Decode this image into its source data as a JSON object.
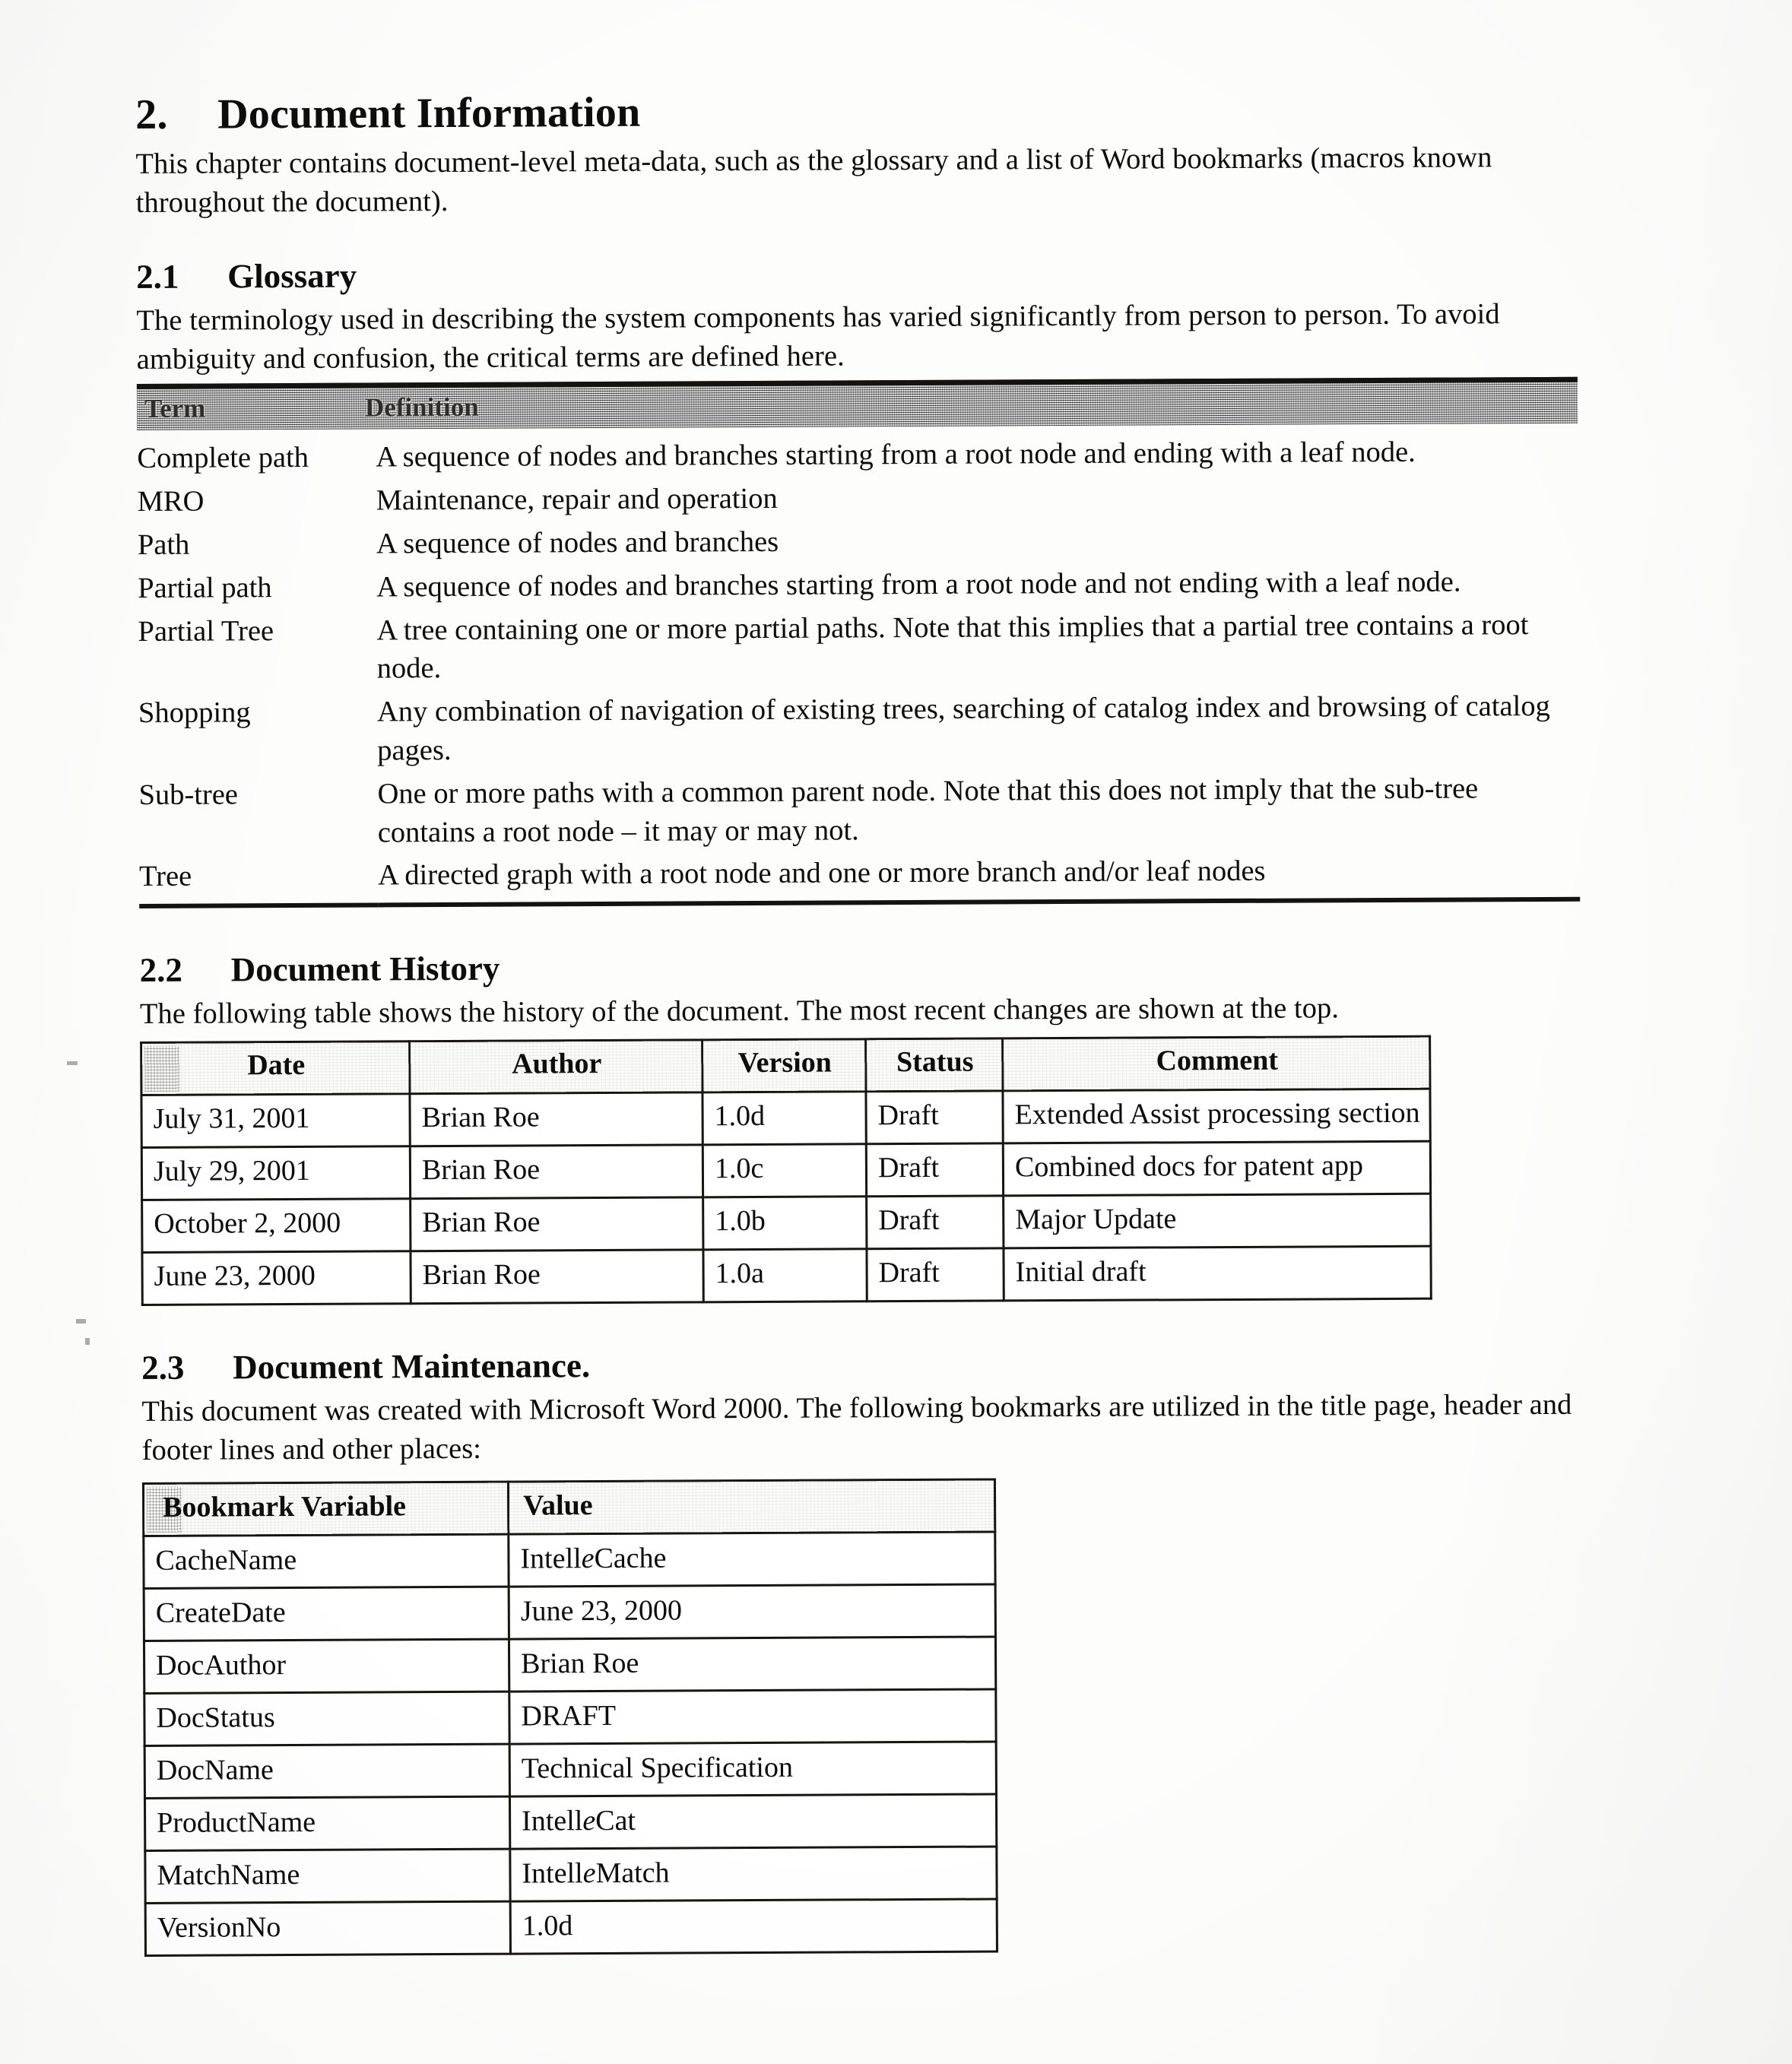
{
  "chapter": {
    "number": "2.",
    "title": "Document Information",
    "intro": "This chapter contains document-level meta-data, such as the glossary and a list of Word bookmarks (macros known throughout the document)."
  },
  "glossary_section": {
    "number": "2.1",
    "title": "Glossary",
    "intro": "The terminology used in describing the system components has varied significantly from person to person.  To avoid ambiguity and confusion, the critical terms are defined here.",
    "table": {
      "headers": [
        "Term",
        "Definition"
      ],
      "rows": [
        {
          "term": "Complete path",
          "definition": "A sequence of nodes and branches starting from a root node and ending with a leaf node."
        },
        {
          "term": "MRO",
          "definition": "Maintenance, repair and operation"
        },
        {
          "term": "Path",
          "definition": "A sequence of nodes and branches"
        },
        {
          "term": "Partial path",
          "definition": "A sequence of nodes and branches starting from a root node and not ending with a leaf node."
        },
        {
          "term": "Partial Tree",
          "definition": "A tree containing one or more partial paths.  Note that this implies that a partial tree contains a root node."
        },
        {
          "term": "Shopping",
          "definition": "Any combination of navigation of existing trees, searching of catalog index and browsing of catalog pages."
        },
        {
          "term": "Sub-tree",
          "definition": "One or more paths with a common parent node.  Note that this does not imply that the sub-tree contains a root node – it may or may not."
        },
        {
          "term": "Tree",
          "definition": "A directed graph with a root node and one or more branch and/or leaf nodes"
        }
      ]
    }
  },
  "history_section": {
    "number": "2.2",
    "title": "Document History",
    "intro": "The following table shows the history of the document.  The most recent changes are shown at the top.",
    "table": {
      "headers": [
        "Date",
        "Author",
        "Version",
        "Status",
        "Comment"
      ],
      "rows": [
        {
          "date": "July 31, 2001",
          "author": "Brian Roe",
          "version": "1.0d",
          "status": "Draft",
          "comment": "Extended Assist processing section"
        },
        {
          "date": "July 29, 2001",
          "author": "Brian Roe",
          "version": "1.0c",
          "status": "Draft",
          "comment": "Combined docs for patent app"
        },
        {
          "date": "October 2, 2000",
          "author": "Brian Roe",
          "version": "1.0b",
          "status": "Draft",
          "comment": "Major Update"
        },
        {
          "date": "June 23, 2000",
          "author": "Brian Roe",
          "version": "1.0a",
          "status": "Draft",
          "comment": "Initial draft"
        }
      ]
    }
  },
  "maintenance_section": {
    "number": "2.3",
    "title": "Document Maintenance.",
    "intro": "This document was created with Microsoft Word 2000. The following bookmarks are utilized in the title page, header and footer lines and other places:",
    "table": {
      "headers": [
        "Bookmark Variable",
        "Value"
      ],
      "rows": [
        {
          "variable": "CacheName",
          "value_pre": "Intell",
          "value_italic": "e",
          "value_post": "Cache"
        },
        {
          "variable": "CreateDate",
          "value_pre": "June 23, 2000",
          "value_italic": "",
          "value_post": ""
        },
        {
          "variable": "DocAuthor",
          "value_pre": "Brian Roe",
          "value_italic": "",
          "value_post": ""
        },
        {
          "variable": "DocStatus",
          "value_pre": "DRAFT",
          "value_italic": "",
          "value_post": ""
        },
        {
          "variable": "DocName",
          "value_pre": "Technical Specification",
          "value_italic": "",
          "value_post": ""
        },
        {
          "variable": "ProductName",
          "value_pre": "Intell",
          "value_italic": "e",
          "value_post": "Cat"
        },
        {
          "variable": "MatchName",
          "value_pre": "Intell",
          "value_italic": "e",
          "value_post": "Match"
        },
        {
          "variable": "VersionNo",
          "value_pre": "1.0d",
          "value_italic": "",
          "value_post": ""
        }
      ]
    }
  }
}
